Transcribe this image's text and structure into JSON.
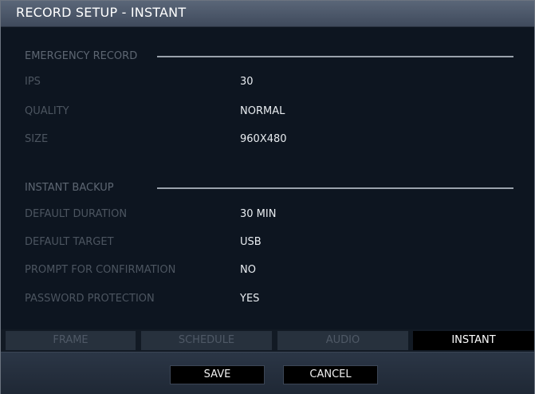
{
  "window": {
    "title": "RECORD SETUP - INSTANT"
  },
  "emergency_record": {
    "heading": "EMERGENCY RECORD",
    "rows": [
      {
        "label": "IPS",
        "value": "30"
      },
      {
        "label": "QUALITY",
        "value": "NORMAL"
      },
      {
        "label": "SIZE",
        "value": "960X480"
      }
    ]
  },
  "instant_backup": {
    "heading": "INSTANT BACKUP",
    "rows": [
      {
        "label": "DEFAULT DURATION",
        "value": "30 MIN"
      },
      {
        "label": "DEFAULT TARGET",
        "value": "USB"
      },
      {
        "label": "PROMPT FOR CONFIRMATION",
        "value": "NO"
      },
      {
        "label": "PASSWORD PROTECTION",
        "value": "YES"
      }
    ]
  },
  "tabs": [
    {
      "label": "FRAME",
      "active": false
    },
    {
      "label": "SCHEDULE",
      "active": false
    },
    {
      "label": "AUDIO",
      "active": false
    },
    {
      "label": "INSTANT",
      "active": true
    }
  ],
  "footer": {
    "save_label": "SAVE",
    "cancel_label": "CANCEL"
  }
}
